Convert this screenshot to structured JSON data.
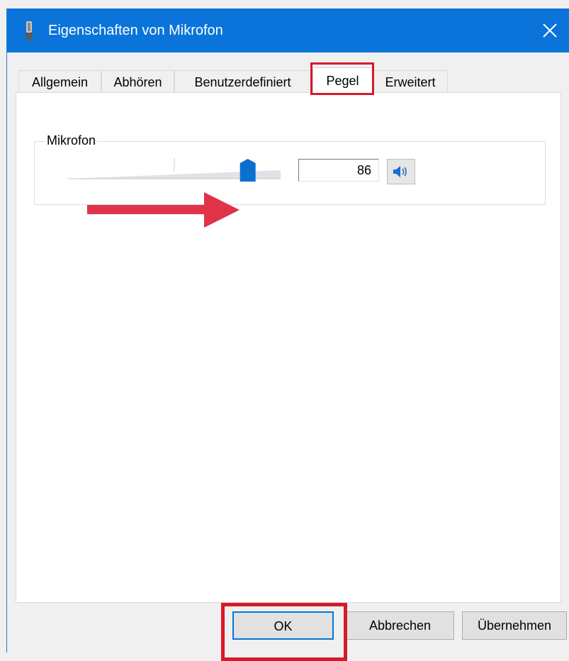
{
  "window": {
    "title": "Eigenschaften von Mikrofon",
    "title_icon": "microphone-icon",
    "close_icon": "close-icon",
    "accent_color": "#0a74da"
  },
  "tabs": [
    {
      "label": "Allgemein",
      "active": false
    },
    {
      "label": "Abhören",
      "active": false
    },
    {
      "label": "Benutzerdefiniert",
      "active": false
    },
    {
      "label": "Pegel",
      "active": true
    },
    {
      "label": "Erweitert",
      "active": false
    }
  ],
  "level": {
    "group_label": "Mikrofon",
    "slider_value_percent": 86,
    "value_text": "86",
    "speaker_icon": "speaker-icon"
  },
  "annotations": {
    "highlight_color": "#d7192c",
    "arrow_icon": "arrow-right-icon"
  },
  "buttons": {
    "ok": "OK",
    "cancel": "Abbrechen",
    "apply": "Übernehmen"
  }
}
